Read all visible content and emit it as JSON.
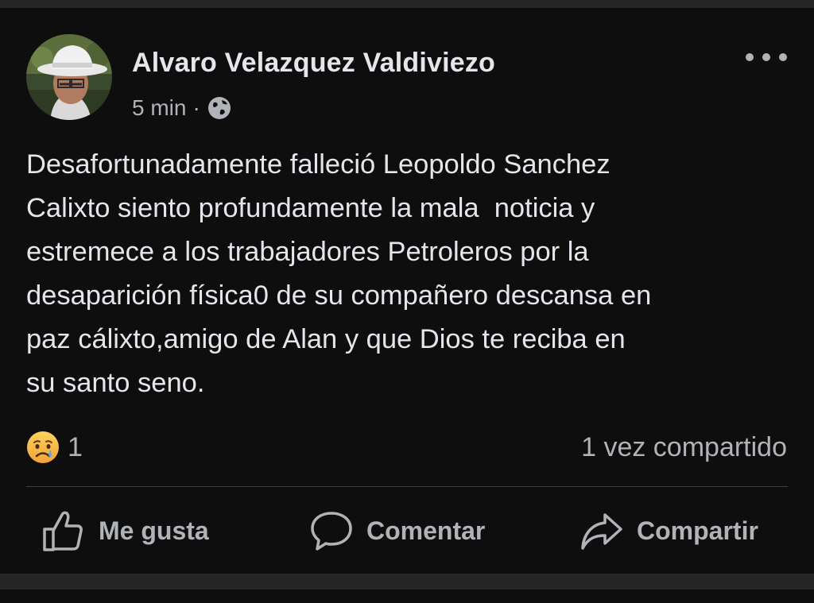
{
  "post": {
    "author": "Alvaro Velazquez Valdiviezo",
    "time": "5 min",
    "separator": "·",
    "audience_icon": "globe-icon",
    "more_icon": "more-horizontal-icon",
    "text": "Desafortunadamente falleció Leopoldo Sanchez\nCalixto siento profundamente la mala  noticia y\nestremece a los trabajadores Petroleros por la\ndesaparición física0 de su compañero descansa en\npaz cálixto,amigo de Alan y que Dios te reciba en\nsu santo seno."
  },
  "reactions": {
    "emoji": "sad-crying-face",
    "count": "1",
    "shares": "1 vez compartido"
  },
  "actions": {
    "like": "Me gusta",
    "comment": "Comentar",
    "share": "Compartir"
  },
  "colors": {
    "background": "#0e0e0f",
    "separator_band": "#242526",
    "primary_text": "#e4e6eb",
    "secondary_text": "#b0b3b8",
    "divider": "#3e4042"
  }
}
